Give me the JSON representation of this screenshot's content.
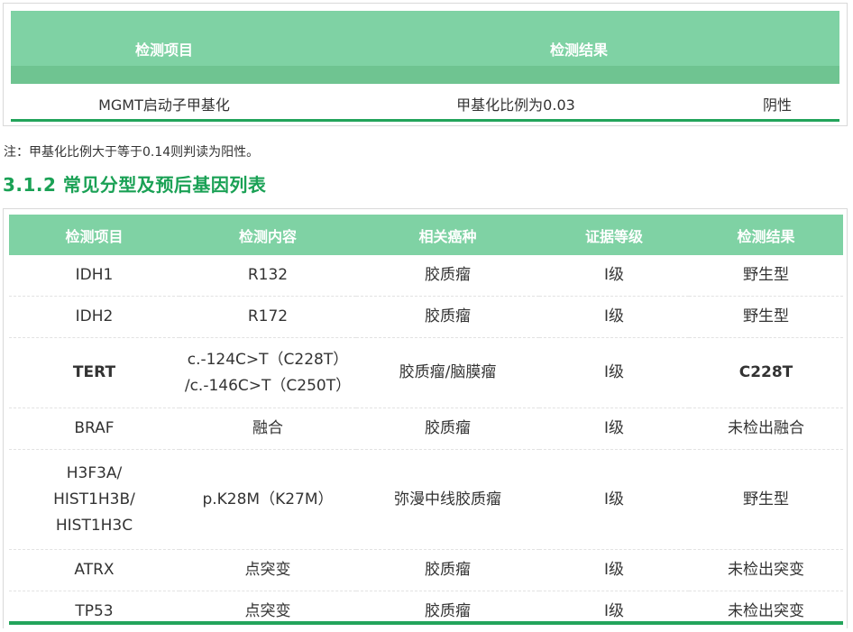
{
  "table1": {
    "headers": [
      "检测项目",
      "检测结果"
    ],
    "row": {
      "item": "MGMT启动子甲基化",
      "ratio": "甲基化比例为0.03",
      "result": "阴性"
    }
  },
  "note": "注：甲基化比例大于等于0.14则判读为阳性。",
  "section_title": "3.1.2 常见分型及预后基因列表",
  "table2": {
    "headers": [
      "检测项目",
      "检测内容",
      "相关癌种",
      "证据等级",
      "检测结果"
    ],
    "rows": [
      {
        "item": "IDH1",
        "content": "R132",
        "cancer": "胶质瘤",
        "level": "I级",
        "result": "野生型"
      },
      {
        "item": "IDH2",
        "content": "R172",
        "cancer": "胶质瘤",
        "level": "I级",
        "result": "野生型"
      },
      {
        "item": "TERT",
        "content_line1": "c.-124C>T（C228T）",
        "content_line2": "/c.-146C>T（C250T）",
        "cancer": "胶质瘤/脑膜瘤",
        "level": "I级",
        "result": "C228T"
      },
      {
        "item": "BRAF",
        "content": "融合",
        "cancer": "胶质瘤",
        "level": "I级",
        "result": "未检出融合"
      },
      {
        "item_line1": "H3F3A/",
        "item_line2": "HIST1H3B/",
        "item_line3": "HIST1H3C",
        "content": "p.K28M（K27M）",
        "cancer": "弥漫中线胶质瘤",
        "level": "I级",
        "result": "野生型"
      },
      {
        "item": "ATRX",
        "content": "点突变",
        "cancer": "胶质瘤",
        "level": "I级",
        "result": "未检出突变"
      },
      {
        "item": "TP53",
        "content": "点突变",
        "cancer": "胶质瘤",
        "level": "I级",
        "result": "未检出突变"
      }
    ]
  },
  "colors": {
    "header_green": "#7fd2a4",
    "accent_green": "#23a45b",
    "title_green": "#1aa155",
    "positive_red": "#d7202d"
  }
}
